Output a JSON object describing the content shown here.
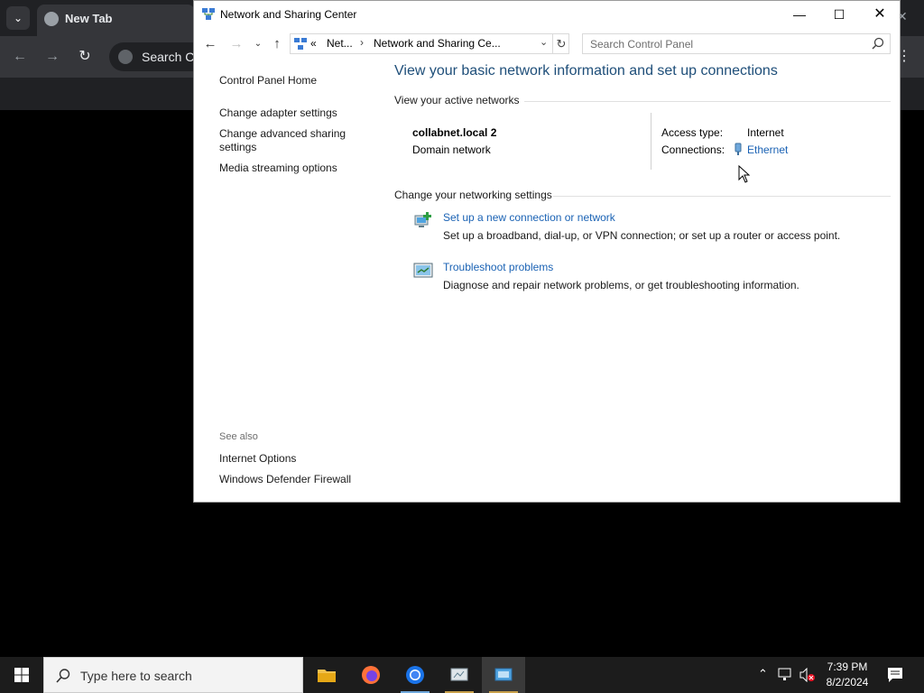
{
  "browser": {
    "tab_title": "New Tab",
    "omnibox_text": "Search Co"
  },
  "window": {
    "title": "Network and Sharing Center",
    "address": {
      "overflow": "«",
      "crumb1": "Net...",
      "crumb2": "Network and Sharing Ce..."
    },
    "search_placeholder": "Search Control Panel",
    "left_links": [
      "Control Panel Home",
      "Change adapter settings",
      "Change advanced sharing settings",
      "Media streaming options"
    ],
    "see_also": {
      "label": "See also",
      "links": [
        "Internet Options",
        "Windows Defender Firewall"
      ]
    },
    "main": {
      "title": "View your basic network information and set up connections",
      "active_networks_label": "View your active networks",
      "network": {
        "name": "collabnet.local 2",
        "type": "Domain network",
        "access_type_label": "Access type:",
        "access_type_value": "Internet",
        "connections_label": "Connections:",
        "connections_value": "Ethernet"
      },
      "change_settings_label": "Change your networking settings",
      "tasks": [
        {
          "link": "Set up a new connection or network",
          "description": "Set up a broadband, dial-up, or VPN connection; or set up a router or access point."
        },
        {
          "link": "Troubleshoot problems",
          "description": "Diagnose and repair network problems, or get troubleshooting information."
        }
      ]
    }
  },
  "taskbar": {
    "search_text": "Type here to search",
    "time": "7:39 PM",
    "date": "8/2/2024"
  },
  "colors": {
    "link": "#1a62b4",
    "title": "#1e4e79",
    "taskbar": "#1c1c1c"
  }
}
